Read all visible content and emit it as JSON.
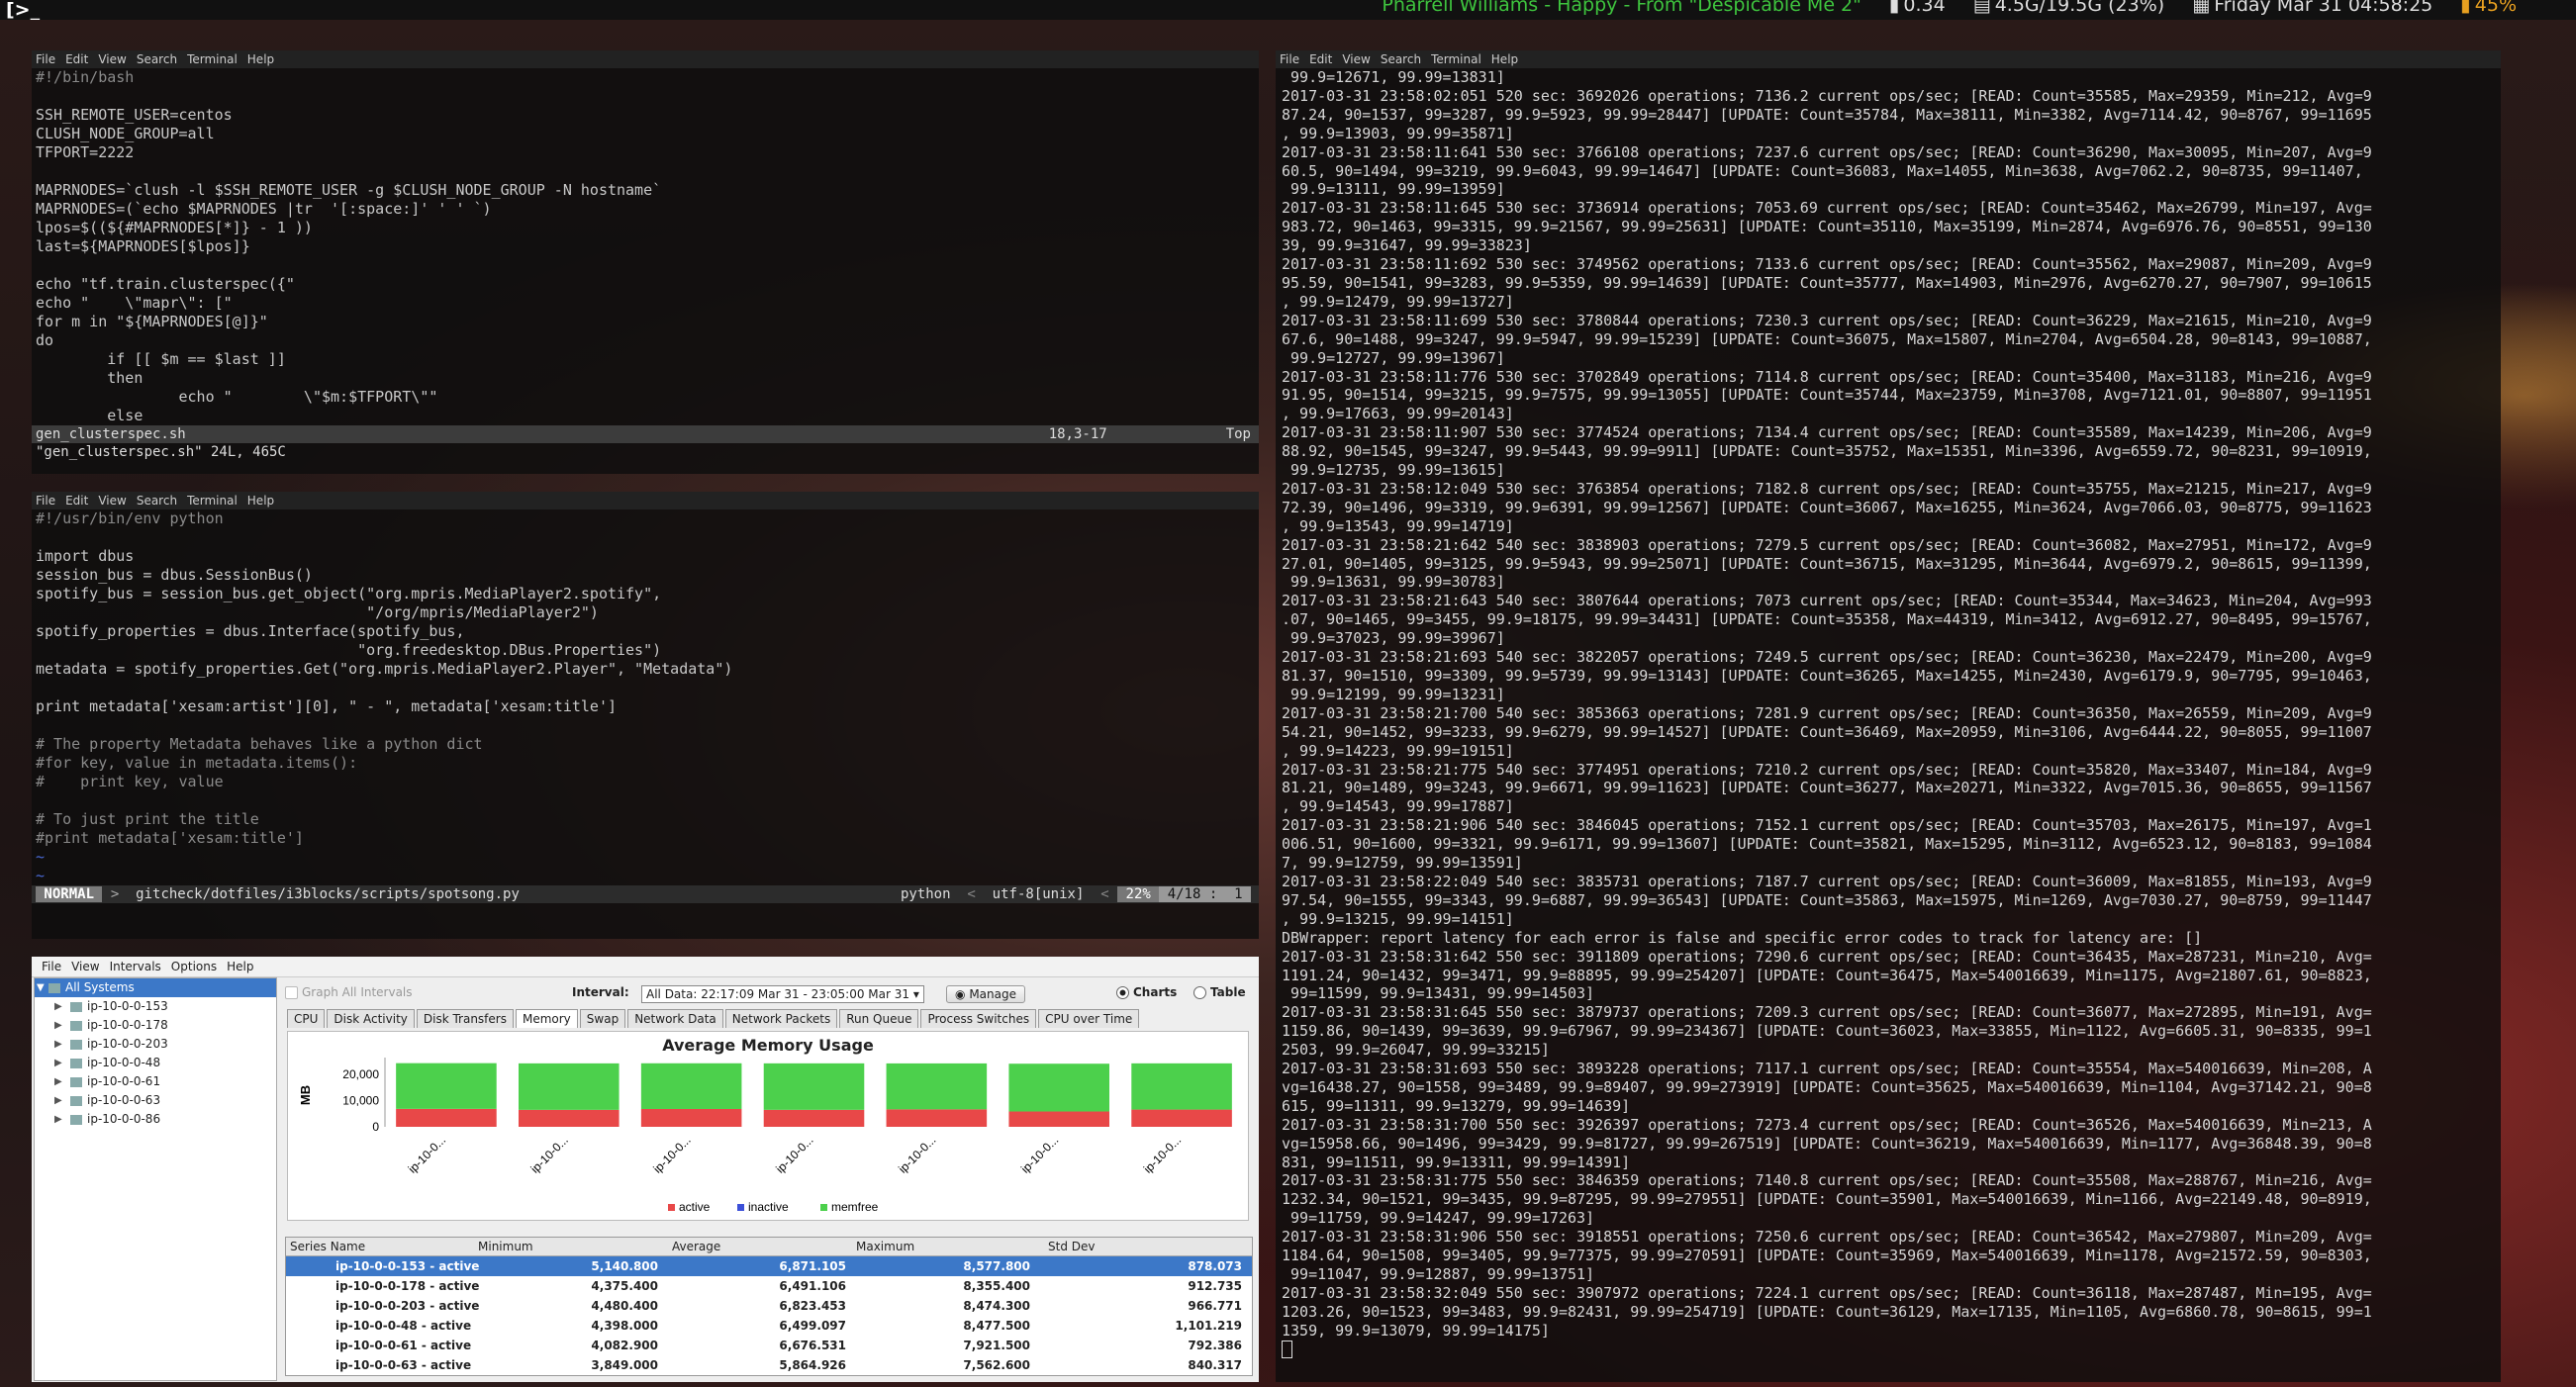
{
  "topbar": {
    "left_glyph": "[>_",
    "song": "Pharrell Williams  -  Happy - From \"Despicable Me 2\"",
    "load": "0.34",
    "memory": "4.5G/19.5G (23%)",
    "datetime": "Friday Mar 31 04:58:25",
    "battery": "45%"
  },
  "term_menu": [
    "File",
    "Edit",
    "View",
    "Search",
    "Terminal",
    "Help"
  ],
  "vim1": {
    "lines": [
      "#!/bin/bash",
      "",
      "SSH_REMOTE_USER=centos",
      "CLUSH_NODE_GROUP=all",
      "TFPORT=2222",
      "",
      "MAPRNODES=`clush -l $SSH_REMOTE_USER -g $CLUSH_NODE_GROUP -N hostname`",
      "MAPRNODES=(`echo $MAPRNODES |tr  '[:space:]' ' ' `)",
      "lpos=$((${#MAPRNODES[*]} - 1 ))",
      "last=${MAPRNODES[$lpos]}",
      "",
      "echo \"tf.train.clusterspec({\"",
      "echo \"    \\\"mapr\\\": [\"",
      "for m in \"${MAPRNODES[@]}\"",
      "do",
      "        if [[ $m == $last ]]",
      "        then",
      "                echo \"        \\\"$m:$TFPORT\\\"\"",
      "        else"
    ],
    "status_file": "gen_clusterspec.sh",
    "status_pos": "18,3-17",
    "status_pct": "Top",
    "cmdline": "\"gen_clusterspec.sh\" 24L, 465C"
  },
  "vim2": {
    "lines": [
      "#!/usr/bin/env python",
      "",
      "import dbus",
      "session_bus = dbus.SessionBus()",
      "spotify_bus = session_bus.get_object(\"org.mpris.MediaPlayer2.spotify\",",
      "                                     \"/org/mpris/MediaPlayer2\")",
      "spotify_properties = dbus.Interface(spotify_bus,",
      "                                    \"org.freedesktop.DBus.Properties\")",
      "metadata = spotify_properties.Get(\"org.mpris.MediaPlayer2.Player\", \"Metadata\")",
      "",
      "print metadata['xesam:artist'][0], \" - \", metadata['xesam:title']",
      "",
      "# The property Metadata behaves like a python dict",
      "#for key, value in metadata.items():",
      "#    print key, value",
      "",
      "# To just print the title",
      "#print metadata['xesam:title']",
      "~",
      "~"
    ],
    "mode": " NORMAL ",
    "path": "gitcheck/dotfiles/i3blocks/scripts/spotsong.py",
    "ft": "python",
    "enc": "utf-8[unix]",
    "pct": " 22% ",
    "pos": "4/18 :  1"
  },
  "log_lines": [
    " 99.9=12671, 99.99=13831]",
    "2017-03-31 23:58:02:051 520 sec: 3692026 operations; 7136.2 current ops/sec; [READ: Count=35585, Max=29359, Min=212, Avg=9",
    "87.24, 90=1537, 99=3287, 99.9=5923, 99.99=28447] [UPDATE: Count=35784, Max=38111, Min=3382, Avg=7114.42, 90=8767, 99=11695",
    ", 99.9=13903, 99.99=35871]",
    "2017-03-31 23:58:11:641 530 sec: 3766108 operations; 7237.6 current ops/sec; [READ: Count=36290, Max=30095, Min=207, Avg=9",
    "60.5, 90=1494, 99=3219, 99.9=6043, 99.99=14647] [UPDATE: Count=36083, Max=14055, Min=3638, Avg=7062.2, 90=8735, 99=11407,",
    " 99.9=13111, 99.99=13959]",
    "2017-03-31 23:58:11:645 530 sec: 3736914 operations; 7053.69 current ops/sec; [READ: Count=35462, Max=26799, Min=197, Avg=",
    "983.72, 90=1463, 99=3315, 99.9=21567, 99.99=25631] [UPDATE: Count=35110, Max=35199, Min=2874, Avg=6976.76, 90=8551, 99=130",
    "39, 99.9=31647, 99.99=33823]",
    "2017-03-31 23:58:11:692 530 sec: 3749562 operations; 7133.6 current ops/sec; [READ: Count=35562, Max=29087, Min=209, Avg=9",
    "95.59, 90=1541, 99=3283, 99.9=5359, 99.99=14639] [UPDATE: Count=35777, Max=14903, Min=2976, Avg=6270.27, 90=7907, 99=10615",
    ", 99.9=12479, 99.99=13727]",
    "2017-03-31 23:58:11:699 530 sec: 3780844 operations; 7230.3 current ops/sec; [READ: Count=36229, Max=21615, Min=210, Avg=9",
    "67.6, 90=1488, 99=3247, 99.9=5947, 99.99=15239] [UPDATE: Count=36075, Max=15807, Min=2704, Avg=6504.28, 90=8143, 99=10887,",
    " 99.9=12727, 99.99=13967]",
    "2017-03-31 23:58:11:776 530 sec: 3702849 operations; 7114.8 current ops/sec; [READ: Count=35400, Max=31183, Min=216, Avg=9",
    "91.95, 90=1514, 99=3215, 99.9=7575, 99.99=13055] [UPDATE: Count=35744, Max=23759, Min=3708, Avg=7121.01, 90=8807, 99=11951",
    ", 99.9=17663, 99.99=20143]",
    "2017-03-31 23:58:11:907 530 sec: 3774524 operations; 7134.4 current ops/sec; [READ: Count=35589, Max=14239, Min=206, Avg=9",
    "88.92, 90=1545, 99=3247, 99.9=5443, 99.99=9911] [UPDATE: Count=35752, Max=15351, Min=3396, Avg=6559.72, 90=8231, 99=10919,",
    " 99.9=12735, 99.99=13615]",
    "2017-03-31 23:58:12:049 530 sec: 3763854 operations; 7182.8 current ops/sec; [READ: Count=35755, Max=21215, Min=217, Avg=9",
    "72.39, 90=1496, 99=3319, 99.9=6391, 99.99=12567] [UPDATE: Count=36067, Max=16255, Min=3624, Avg=7066.03, 90=8775, 99=11623",
    ", 99.9=13543, 99.99=14719]",
    "2017-03-31 23:58:21:642 540 sec: 3838903 operations; 7279.5 current ops/sec; [READ: Count=36082, Max=27951, Min=172, Avg=9",
    "27.01, 90=1405, 99=3125, 99.9=5943, 99.99=25071] [UPDATE: Count=36715, Max=31295, Min=3644, Avg=6979.2, 90=8615, 99=11399,",
    " 99.9=13631, 99.99=30783]",
    "2017-03-31 23:58:21:643 540 sec: 3807644 operations; 7073 current ops/sec; [READ: Count=35344, Max=34623, Min=204, Avg=993",
    ".07, 90=1465, 99=3455, 99.9=18175, 99.99=34431] [UPDATE: Count=35358, Max=44319, Min=3412, Avg=6912.27, 90=8495, 99=15767,",
    " 99.9=37023, 99.99=39967]",
    "2017-03-31 23:58:21:693 540 sec: 3822057 operations; 7249.5 current ops/sec; [READ: Count=36230, Max=22479, Min=200, Avg=9",
    "81.37, 90=1510, 99=3309, 99.9=5739, 99.99=13143] [UPDATE: Count=36265, Max=14255, Min=2430, Avg=6179.9, 90=7795, 99=10463,",
    " 99.9=12199, 99.99=13231]",
    "2017-03-31 23:58:21:700 540 sec: 3853663 operations; 7281.9 current ops/sec; [READ: Count=36350, Max=26559, Min=209, Avg=9",
    "54.21, 90=1452, 99=3233, 99.9=6279, 99.99=14527] [UPDATE: Count=36469, Max=20959, Min=3106, Avg=6444.22, 90=8055, 99=11007",
    ", 99.9=14223, 99.99=19151]",
    "2017-03-31 23:58:21:775 540 sec: 3774951 operations; 7210.2 current ops/sec; [READ: Count=35820, Max=33407, Min=184, Avg=9",
    "81.21, 90=1489, 99=3243, 99.9=6671, 99.99=11623] [UPDATE: Count=36277, Max=20271, Min=3322, Avg=7015.36, 90=8655, 99=11567",
    ", 99.9=14543, 99.99=17887]",
    "2017-03-31 23:58:21:906 540 sec: 3846045 operations; 7152.1 current ops/sec; [READ: Count=35703, Max=26175, Min=197, Avg=1",
    "006.51, 90=1600, 99=3321, 99.9=6171, 99.99=13607] [UPDATE: Count=35821, Max=15295, Min=3112, Avg=6523.12, 90=8183, 99=1084",
    "7, 99.9=12759, 99.99=13591]",
    "2017-03-31 23:58:22:049 540 sec: 3835731 operations; 7187.7 current ops/sec; [READ: Count=36009, Max=81855, Min=193, Avg=9",
    "97.54, 90=1555, 99=3343, 99.9=6887, 99.99=36543] [UPDATE: Count=35863, Max=15975, Min=1269, Avg=7030.27, 90=8759, 99=11447",
    ", 99.9=13215, 99.99=14151]",
    "DBWrapper: report latency for each error is false and specific error codes to track for latency are: []",
    "2017-03-31 23:58:31:642 550 sec: 3911809 operations; 7290.6 current ops/sec; [READ: Count=36435, Max=287231, Min=210, Avg=",
    "1191.24, 90=1432, 99=3471, 99.9=88895, 99.99=254207] [UPDATE: Count=36475, Max=540016639, Min=1175, Avg=21807.61, 90=8823,",
    " 99=11599, 99.9=13431, 99.99=14503]",
    "2017-03-31 23:58:31:645 550 sec: 3879737 operations; 7209.3 current ops/sec; [READ: Count=36077, Max=272895, Min=191, Avg=",
    "1159.86, 90=1439, 99=3639, 99.9=67967, 99.99=234367] [UPDATE: Count=36023, Max=33855, Min=1122, Avg=6605.31, 90=8335, 99=1",
    "2503, 99.9=26047, 99.99=33215]",
    "2017-03-31 23:58:31:693 550 sec: 3893228 operations; 7117.1 current ops/sec; [READ: Count=35554, Max=540016639, Min=208, A",
    "vg=16438.27, 90=1558, 99=3489, 99.9=89407, 99.99=273919] [UPDATE: Count=35625, Max=540016639, Min=1104, Avg=37142.21, 90=8",
    "615, 99=11311, 99.9=13279, 99.99=14639]",
    "2017-03-31 23:58:31:700 550 sec: 3926397 operations; 7273.4 current ops/sec; [READ: Count=36526, Max=540016639, Min=213, A",
    "vg=15958.66, 90=1496, 99=3429, 99.9=81727, 99.99=267519] [UPDATE: Count=36219, Max=540016639, Min=1177, Avg=36848.39, 90=8",
    "831, 99=11511, 99.9=13311, 99.99=14391]",
    "2017-03-31 23:58:31:775 550 sec: 3846359 operations; 7140.8 current ops/sec; [READ: Count=35508, Max=288767, Min=216, Avg=",
    "1232.34, 90=1521, 99=3435, 99.9=87295, 99.99=279551] [UPDATE: Count=35901, Max=540016639, Min=1166, Avg=22149.48, 90=8919,",
    " 99=11759, 99.9=14247, 99.99=17263]",
    "2017-03-31 23:58:31:906 550 sec: 3918551 operations; 7250.6 current ops/sec; [READ: Count=36542, Max=279807, Min=209, Avg=",
    "1184.64, 90=1508, 99=3405, 99.9=77375, 99.99=270591] [UPDATE: Count=35969, Max=540016639, Min=1178, Avg=21572.59, 90=8303,",
    " 99=11047, 99.9=12887, 99.99=13751]",
    "2017-03-31 23:58:32:049 550 sec: 3907972 operations; 7224.1 current ops/sec; [READ: Count=36118, Max=287487, Min=195, Avg=",
    "1203.26, 90=1523, 99=3483, 99.9=82431, 99.99=254719] [UPDATE: Count=36129, Max=17135, Min=1105, Avg=6860.78, 90=8615, 99=1",
    "1359, 99.9=13079, 99.99=14175]"
  ],
  "app": {
    "menu": [
      "File",
      "View",
      "Intervals",
      "Options",
      "Help"
    ],
    "tree_root": "All Systems",
    "tree_items": [
      "ip-10-0-0-153",
      "ip-10-0-0-178",
      "ip-10-0-0-203",
      "ip-10-0-0-48",
      "ip-10-0-0-61",
      "ip-10-0-0-63",
      "ip-10-0-0-86"
    ],
    "graph_all": "Graph All Intervals",
    "interval_label": "Interval:",
    "interval_value": "All Data: 22:17:09 Mar 31 - 23:05:00 Mar 31",
    "manage": "Manage",
    "charts": "Charts",
    "table": "Table",
    "tabs": [
      "CPU",
      "Disk Activity",
      "Disk Transfers",
      "Memory",
      "Swap",
      "Network Data",
      "Network Packets",
      "Run Queue",
      "Process Switches",
      "CPU over Time"
    ],
    "active_tab": "Memory",
    "columns": [
      "Series Name",
      "Minimum",
      "Average",
      "Maximum",
      "Std Dev"
    ],
    "rows": [
      {
        "name": "ip-10-0-0-153 - active",
        "min": "5,140.800",
        "avg": "6,871.105",
        "max": "8,577.800",
        "std": "878.073"
      },
      {
        "name": "ip-10-0-0-178 - active",
        "min": "4,375.400",
        "avg": "6,491.106",
        "max": "8,355.400",
        "std": "912.735"
      },
      {
        "name": "ip-10-0-0-203 - active",
        "min": "4,480.400",
        "avg": "6,823.453",
        "max": "8,474.300",
        "std": "966.771"
      },
      {
        "name": "ip-10-0-0-48 - active",
        "min": "4,398.000",
        "avg": "6,499.097",
        "max": "8,477.500",
        "std": "1,101.219"
      },
      {
        "name": "ip-10-0-0-61 - active",
        "min": "4,082.900",
        "avg": "6,676.531",
        "max": "7,921.500",
        "std": "792.386"
      },
      {
        "name": "ip-10-0-0-63 - active",
        "min": "3,849.000",
        "avg": "5,864.926",
        "max": "7,562.600",
        "std": "840.317"
      }
    ]
  },
  "chart_data": {
    "type": "bar",
    "title": "Average Memory Usage",
    "ylabel": "MB",
    "ylim": [
      0,
      25000
    ],
    "yticks": [
      "20,000",
      "10,000",
      "0"
    ],
    "categories": [
      "ip-10-0...",
      "ip-10-0...",
      "ip-10-0...",
      "ip-10-0...",
      "ip-10-0...",
      "ip-10-0...",
      "ip-10-0..."
    ],
    "series": [
      {
        "name": "active",
        "color": "#e84848",
        "values": [
          6871,
          6491,
          6823,
          6499,
          6677,
          5865,
          6600
        ]
      },
      {
        "name": "inactive",
        "color": "#3c50d8",
        "values": [
          0,
          0,
          0,
          0,
          0,
          0,
          0
        ]
      },
      {
        "name": "memfree",
        "color": "#4cd04c",
        "values": [
          17500,
          17800,
          17500,
          17800,
          17600,
          18300,
          17700
        ]
      }
    ],
    "legend": "bottom"
  }
}
